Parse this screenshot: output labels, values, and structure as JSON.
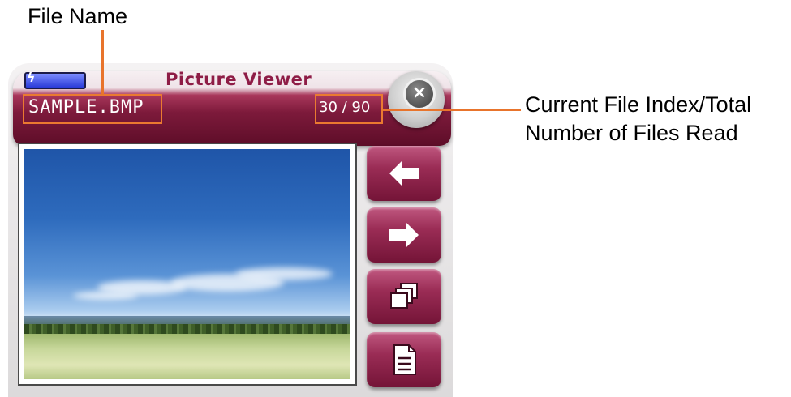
{
  "callouts": {
    "file_name": "File Name",
    "file_index_line1": "Current File Index/Total",
    "file_index_line2": "Number of Files Read"
  },
  "app": {
    "title": "Picture Viewer",
    "file_name": "SAMPLE.BMP",
    "file_index": "30 / 90",
    "close_glyph": "×"
  },
  "battery_icon": "battery-icon",
  "side_buttons": [
    {
      "name": "previous-button",
      "icon": "arrow-left-icon"
    },
    {
      "name": "next-button",
      "icon": "arrow-right-icon"
    },
    {
      "name": "thumbnail-view-button",
      "icon": "stacked-pages-icon"
    },
    {
      "name": "file-info-button",
      "icon": "document-icon"
    }
  ],
  "colors": {
    "accent": "#8e1c46",
    "callout_line": "#e8742c",
    "button": "#9a2c55"
  }
}
